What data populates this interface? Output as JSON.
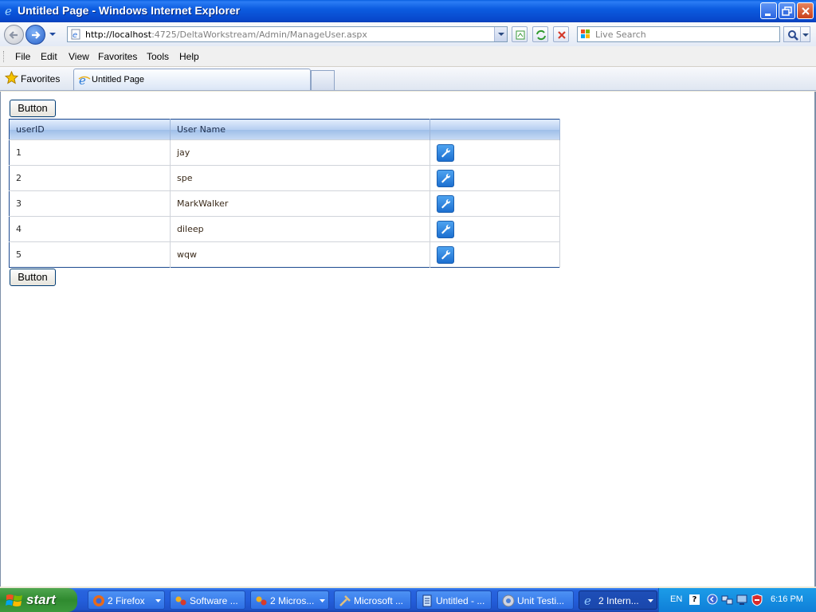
{
  "window": {
    "title": "Untitled Page - Windows Internet Explorer",
    "address_url_host": "http://localhost",
    "address_url_rest": ":4725/DeltaWorkstream/Admin/ManageUser.aspx",
    "search_placeholder": "Live Search"
  },
  "menu": [
    "File",
    "Edit",
    "View",
    "Favorites",
    "Tools",
    "Help"
  ],
  "favorites_label": "Favorites",
  "tab_title": "Untitled Page",
  "page": {
    "top_button_label": "Button",
    "bottom_button_label": "Button",
    "grid": {
      "headers": [
        "userID",
        "User Name",
        ""
      ],
      "rows": [
        {
          "id": "1",
          "name": "jay"
        },
        {
          "id": "2",
          "name": "spe"
        },
        {
          "id": "3",
          "name": "MarkWalker"
        },
        {
          "id": "4",
          "name": "dileep"
        },
        {
          "id": "5",
          "name": "wqw"
        }
      ]
    }
  },
  "taskbar": {
    "start_label": "start",
    "tasks": [
      {
        "label": "2 Firefox",
        "icon": "firefox-icon"
      },
      {
        "label": "Software ...",
        "icon": "software-icon"
      },
      {
        "label": "2 Micros...",
        "icon": "visual-studio-icon"
      },
      {
        "label": "Microsoft ...",
        "icon": "tools-icon"
      },
      {
        "label": "Untitled - ...",
        "icon": "notepad-icon"
      },
      {
        "label": "Unit Testi...",
        "icon": "chrome-icon"
      },
      {
        "label": "2 Intern...",
        "icon": "ie-icon"
      }
    ],
    "tray_lang": "EN",
    "tray_help": "?",
    "clock": "6:16 PM"
  },
  "colors": {
    "titlebar": "#0c5ce0",
    "grid_border": "#1c4a8f",
    "edit_button": "#1c6fd0",
    "taskbar": "#245edb",
    "start_button": "#2f8a2f"
  }
}
